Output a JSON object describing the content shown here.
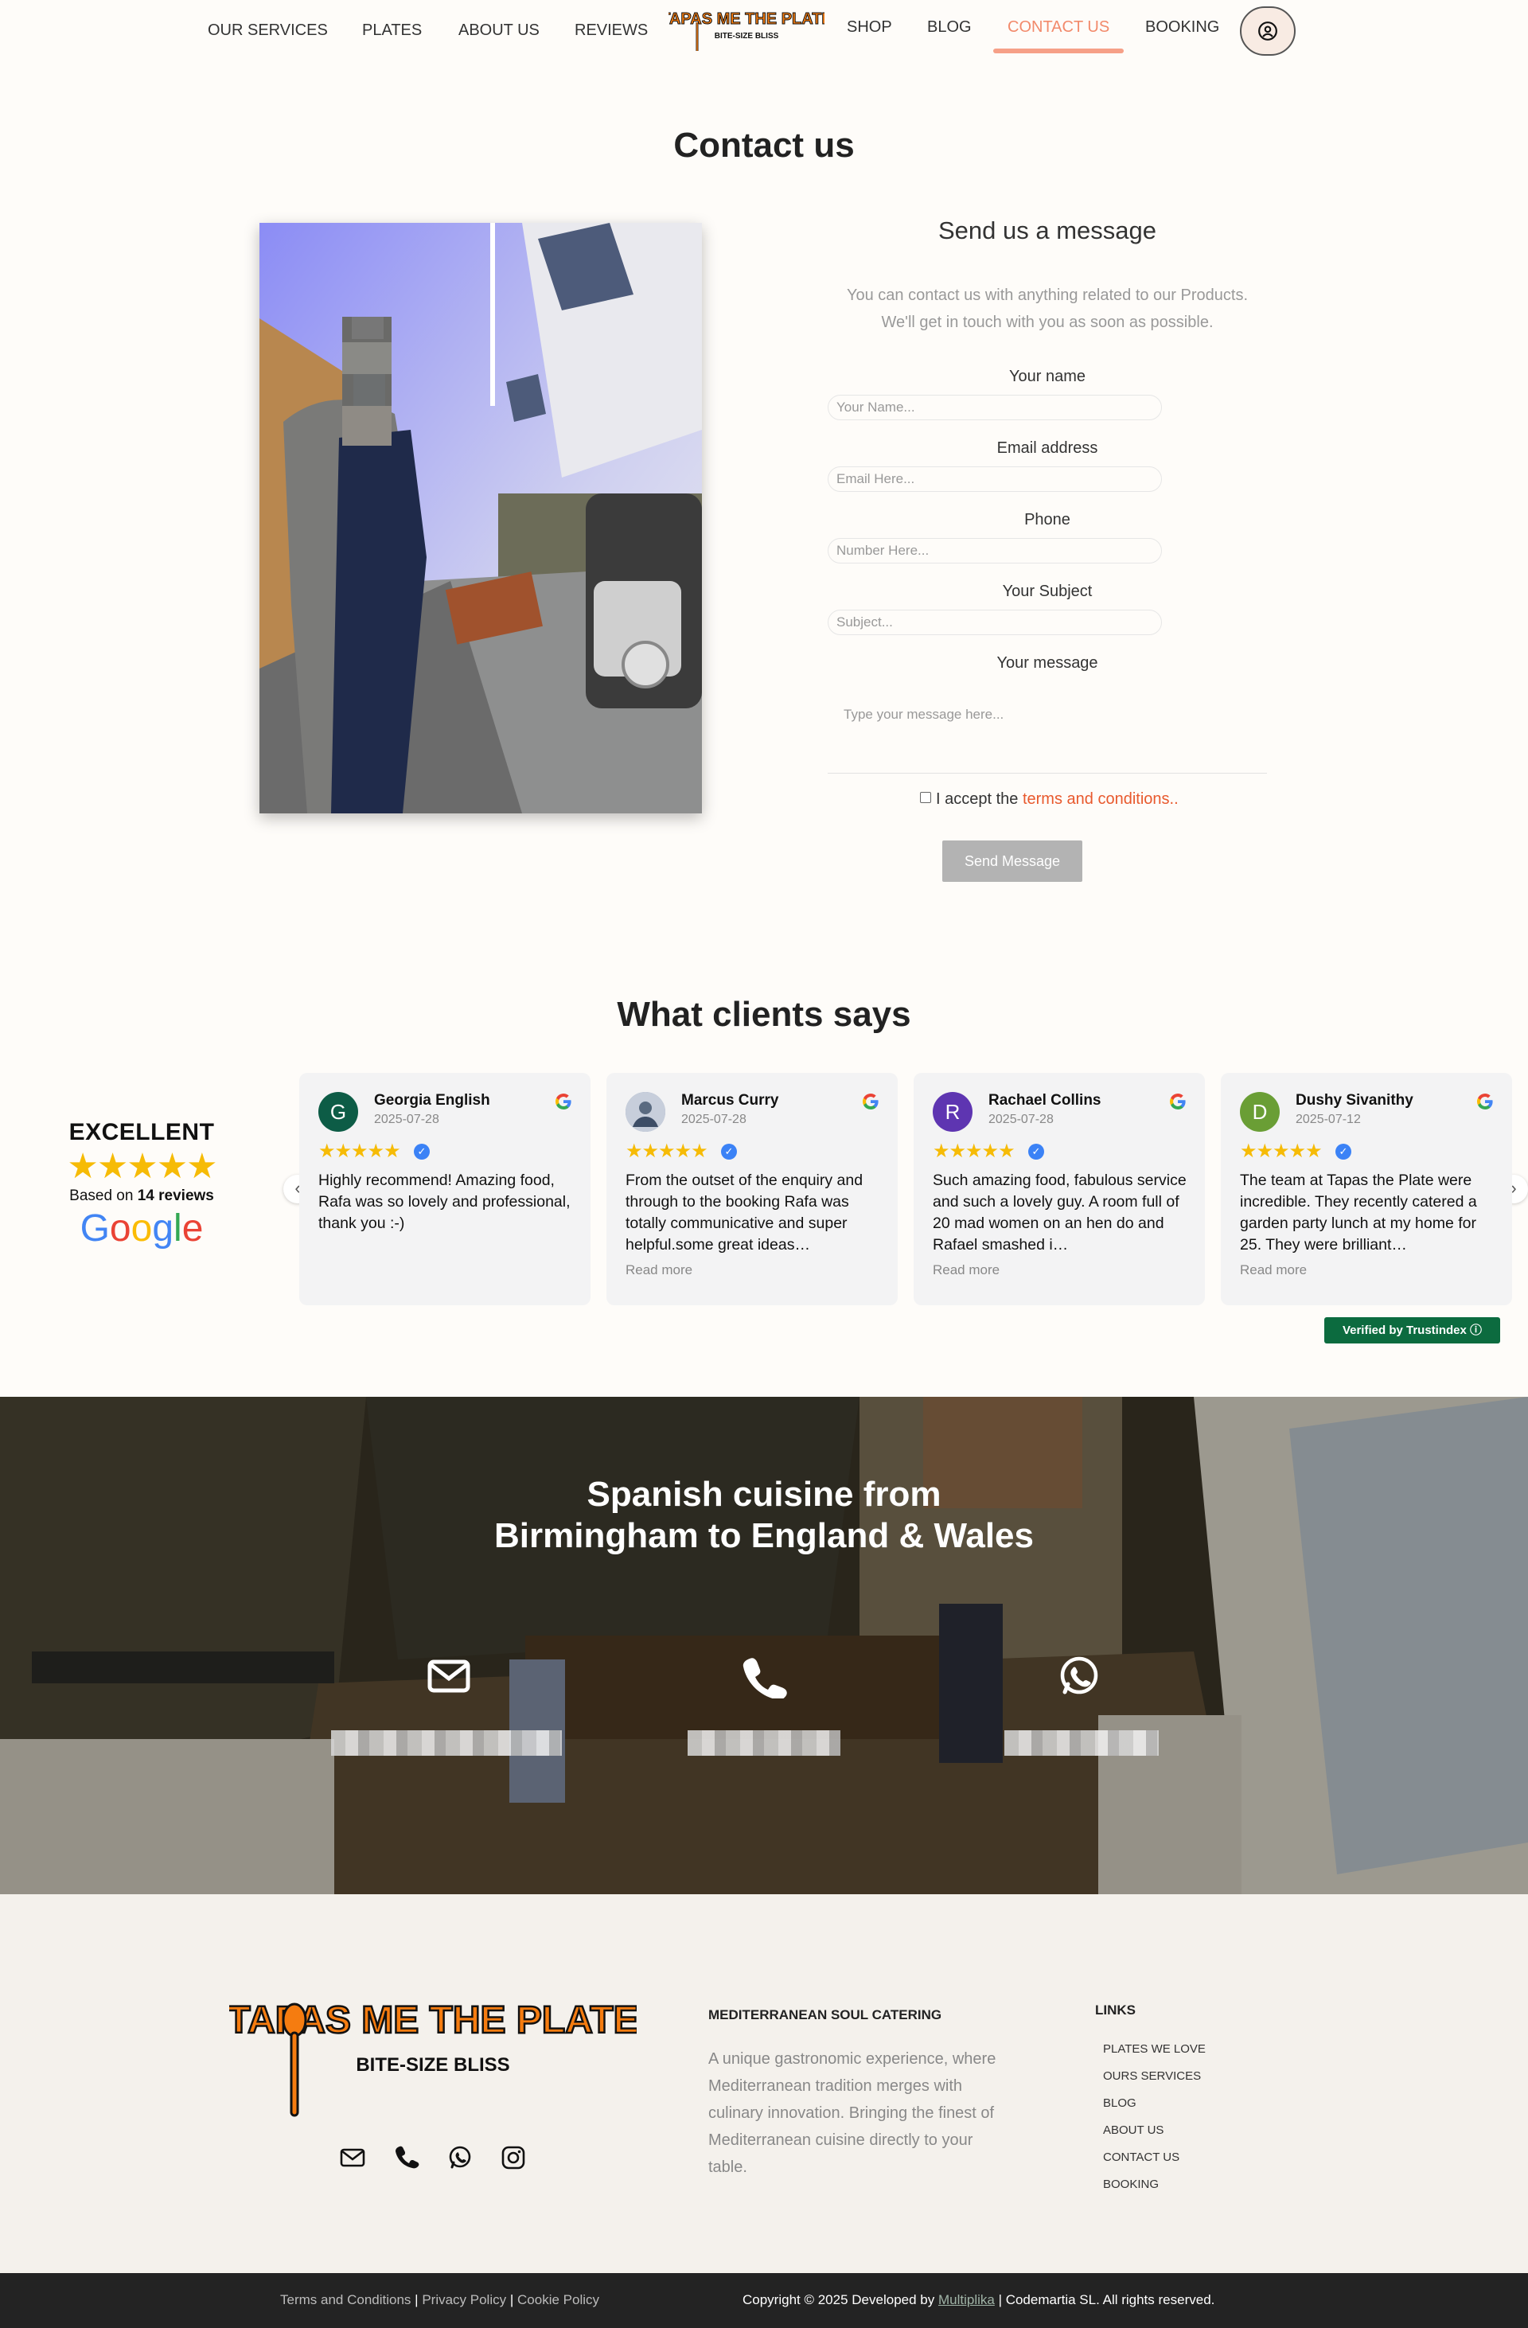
{
  "nav": {
    "items": [
      "OUR SERVICES",
      "PLATES",
      "ABOUT US",
      "REVIEWS",
      "SHOP",
      "BLOG",
      "CONTACT US",
      "BOOKING"
    ],
    "logo_title": "TAPAS ME THE PLATE",
    "logo_subtitle": "BITE-SIZE BLISS",
    "active": "CONTACT US"
  },
  "contact": {
    "title": "Contact us",
    "form_title": "Send us a message",
    "intro_line1": "You can contact us with anything related to our Products.",
    "intro_line2": "We'll get in touch with you as soon as possible.",
    "fields": [
      {
        "label": "Your name",
        "placeholder": "Your Name..."
      },
      {
        "label": "Email address",
        "placeholder": "Email Here..."
      },
      {
        "label": "Phone",
        "placeholder": "Number Here..."
      },
      {
        "label": "Your Subject",
        "placeholder": "Subject..."
      }
    ],
    "message_label": "Your message",
    "message_placeholder": "Type your message here...",
    "terms_prefix": "I accept the",
    "terms_link": "terms and conditions.",
    "terms_suffix": ".",
    "send_label": "Send Message"
  },
  "reviews": {
    "title": "What clients says",
    "rating_word": "EXCELLENT",
    "stars": "★★★★★",
    "based_on_prefix": "Based on",
    "based_on_count": "14 reviews",
    "google": "Google",
    "read_more": "Read more",
    "trustindex": "Verified by Trustindex",
    "cards": [
      {
        "initial": "G",
        "name": "Georgia English",
        "date": "2025-07-28",
        "color": "#0d5c46",
        "text": "Highly recommend! Amazing food, Rafa was so lovely and professional, thank you :-)",
        "read_more": false
      },
      {
        "initial": "",
        "name": "Marcus Curry",
        "date": "2025-07-28",
        "color": "#8a9bb5",
        "text": "From the outset of the enquiry and through to the booking Rafa was totally communicative and super helpful.some great ideas…",
        "read_more": true
      },
      {
        "initial": "R",
        "name": "Rachael Collins",
        "date": "2025-07-28",
        "color": "#5e35b1",
        "text": "Such amazing food, fabulous service and such a lovely guy. A room full of 20 mad women on an hen do and Rafael smashed i…",
        "read_more": true
      },
      {
        "initial": "D",
        "name": "Dushy Sivanithy",
        "date": "2025-07-12",
        "color": "#6a9e35",
        "text": "The team at Tapas the Plate were incredible. They recently catered a garden party lunch at my home for 25. They were brilliant…",
        "read_more": true
      }
    ]
  },
  "hero": {
    "line1": "Spanish cuisine from",
    "line2": "Birmingham to England & Wales",
    "icons": [
      "envelope-icon",
      "phone-icon",
      "whatsapp-icon"
    ]
  },
  "footer": {
    "brand_title": "TAPAS ME THE PLATE",
    "brand_subtitle": "BITE-SIZE BLISS",
    "heading": "MEDITERRANEAN SOUL CATERING",
    "description": "A unique gastronomic experience, where Mediterranean tradition merges with culinary innovation. Bringing the finest of Mediterranean cuisine directly to your table.",
    "links_heading": "LINKS",
    "links": [
      "PLATES WE LOVE",
      "OURS SERVICES",
      "BLOG",
      "ABOUT US",
      "CONTACT US",
      "BOOKING"
    ],
    "legal": [
      "Terms and Conditions",
      "Privacy Policy",
      "Cookie Policy"
    ],
    "copyright_prefix": "Copyright © 2025 Developed by",
    "developer": "Multiplika",
    "copyright_suffix": "| Codemartia SL. All rights reserved."
  },
  "colors": {
    "accent": "#f28a6b",
    "terms_link": "#e8592d",
    "logo_orange": "#f57c10",
    "trustindex_green": "#0c6b3f",
    "star": "#f6bb06"
  }
}
